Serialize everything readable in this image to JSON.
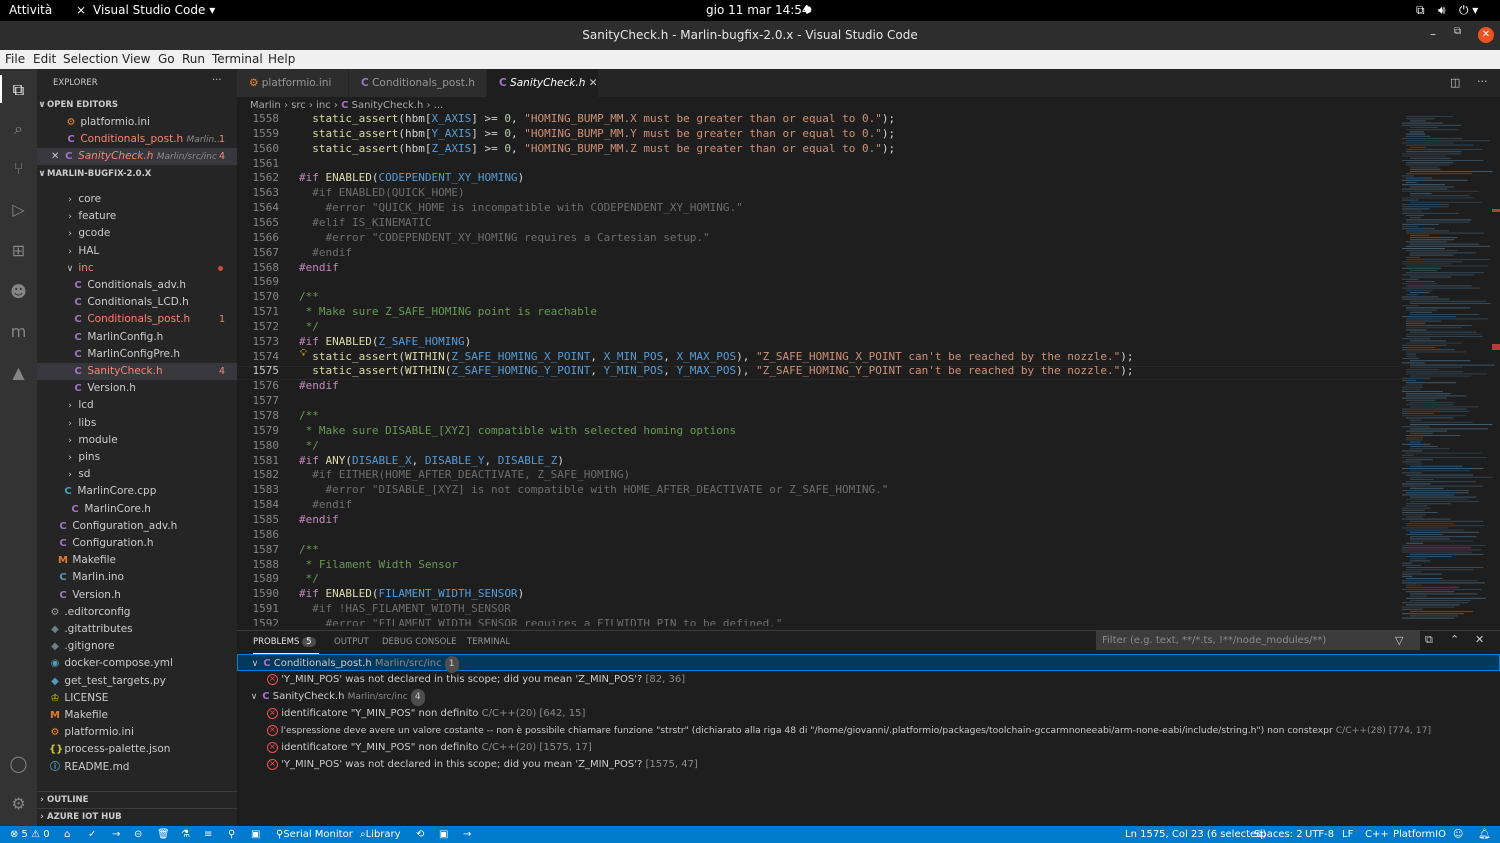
{
  "os_bar": {
    "activities": "Attività",
    "app_name": "Visual Studio Code",
    "clock": "gio 11 mar  14:54"
  },
  "window": {
    "title": "SanityCheck.h - Marlin-bugfix-2.0.x - Visual Studio Code"
  },
  "menu": [
    "File",
    "Edit",
    "Selection",
    "View",
    "Go",
    "Run",
    "Terminal",
    "Help"
  ],
  "sidebar": {
    "title": "EXPLORER",
    "open_editors_header": "OPEN EDITORS",
    "open_editors": [
      {
        "name": "platformio.ini",
        "path": "",
        "badge": ""
      },
      {
        "name": "Conditionals_post.h",
        "path": "Marlin...",
        "badge": "1"
      },
      {
        "name": "SanityCheck.h",
        "path": "Marlin/src/inc",
        "badge": "4"
      }
    ],
    "project_header": "MARLIN-BUGFIX-2.0.X",
    "tree": [
      {
        "name": "core",
        "type": "folder"
      },
      {
        "name": "feature",
        "type": "folder"
      },
      {
        "name": "gcode",
        "type": "folder"
      },
      {
        "name": "HAL",
        "type": "folder"
      },
      {
        "name": "inc",
        "type": "folder-open"
      },
      {
        "name": "Conditionals_adv.h",
        "type": "c"
      },
      {
        "name": "Conditionals_LCD.h",
        "type": "c"
      },
      {
        "name": "Conditionals_post.h",
        "type": "c",
        "badge": "1"
      },
      {
        "name": "MarlinConfig.h",
        "type": "c"
      },
      {
        "name": "MarlinConfigPre.h",
        "type": "c"
      },
      {
        "name": "SanityCheck.h",
        "type": "c",
        "badge": "4"
      },
      {
        "name": "Version.h",
        "type": "c"
      },
      {
        "name": "lcd",
        "type": "folder"
      },
      {
        "name": "libs",
        "type": "folder"
      },
      {
        "name": "module",
        "type": "folder"
      },
      {
        "name": "pins",
        "type": "folder"
      },
      {
        "name": "sd",
        "type": "folder"
      },
      {
        "name": "MarlinCore.cpp",
        "type": "cpp"
      },
      {
        "name": "MarlinCore.h",
        "type": "c"
      },
      {
        "name": "Configuration_adv.h",
        "type": "c"
      },
      {
        "name": "Configuration.h",
        "type": "c"
      },
      {
        "name": "Makefile",
        "type": "make"
      },
      {
        "name": "Marlin.ino",
        "type": "ino"
      },
      {
        "name": "Version.h",
        "type": "c"
      },
      {
        "name": ".editorconfig",
        "type": "gear"
      },
      {
        "name": ".gitattributes",
        "type": "git"
      },
      {
        "name": ".gitignore",
        "type": "git"
      },
      {
        "name": "docker-compose.yml",
        "type": "docker"
      },
      {
        "name": "get_test_targets.py",
        "type": "py"
      },
      {
        "name": "LICENSE",
        "type": "license"
      },
      {
        "name": "Makefile",
        "type": "make"
      },
      {
        "name": "platformio.ini",
        "type": "pio"
      },
      {
        "name": "process-palette.json",
        "type": "json"
      },
      {
        "name": "README.md",
        "type": "md"
      }
    ],
    "outline": "OUTLINE",
    "azure": "AZURE IOT HUB"
  },
  "tabs": [
    {
      "label": "platformio.ini",
      "active": false
    },
    {
      "label": "Conditionals_post.h",
      "active": false
    },
    {
      "label": "SanityCheck.h",
      "active": true
    }
  ],
  "breadcrumb": [
    "Marlin",
    "src",
    "inc",
    "SanityCheck.h",
    "..."
  ],
  "code_lines": [
    {
      "n": "1558",
      "t": "  static_assert(hbm[X_AXIS] >= 0, \"HOMING_BUMP_MM.X must be greater than or equal to 0.\");"
    },
    {
      "n": "1559",
      "t": "  static_assert(hbm[Y_AXIS] >= 0, \"HOMING_BUMP_MM.Y must be greater than or equal to 0.\");"
    },
    {
      "n": "1560",
      "t": "  static_assert(hbm[Z_AXIS] >= 0, \"HOMING_BUMP_MM.Z must be greater than or equal to 0.\");"
    },
    {
      "n": "1561",
      "t": ""
    },
    {
      "n": "1562",
      "t": "#if ENABLED(CODEPENDENT_XY_HOMING)"
    },
    {
      "n": "1563",
      "t": "  #if ENABLED(QUICK_HOME)"
    },
    {
      "n": "1564",
      "t": "    #error \"QUICK_HOME is incompatible with CODEPENDENT_XY_HOMING.\""
    },
    {
      "n": "1565",
      "t": "  #elif IS_KINEMATIC"
    },
    {
      "n": "1566",
      "t": "    #error \"CODEPENDENT_XY_HOMING requires a Cartesian setup.\""
    },
    {
      "n": "1567",
      "t": "  #endif"
    },
    {
      "n": "1568",
      "t": "#endif"
    },
    {
      "n": "1569",
      "t": ""
    },
    {
      "n": "1570",
      "t": "/**"
    },
    {
      "n": "1571",
      "t": " * Make sure Z_SAFE_HOMING point is reachable"
    },
    {
      "n": "1572",
      "t": " */"
    },
    {
      "n": "1573",
      "t": "#if ENABLED(Z_SAFE_HOMING)"
    },
    {
      "n": "1574",
      "t": "  static_assert(WITHIN(Z_SAFE_HOMING_X_POINT, X_MIN_POS, X_MAX_POS), \"Z_SAFE_HOMING_X_POINT can't be reached by the nozzle.\");"
    },
    {
      "n": "1575",
      "t": "  static_assert(WITHIN(Z_SAFE_HOMING_Y_POINT, Y_MIN_POS, Y_MAX_POS), \"Z_SAFE_HOMING_Y_POINT can't be reached by the nozzle.\");"
    },
    {
      "n": "1576",
      "t": "#endif"
    },
    {
      "n": "1577",
      "t": ""
    },
    {
      "n": "1578",
      "t": "/**"
    },
    {
      "n": "1579",
      "t": " * Make sure DISABLE_[XYZ] compatible with selected homing options"
    },
    {
      "n": "1580",
      "t": " */"
    },
    {
      "n": "1581",
      "t": "#if ANY(DISABLE_X, DISABLE_Y, DISABLE_Z)"
    },
    {
      "n": "1582",
      "t": "  #if EITHER(HOME_AFTER_DEACTIVATE, Z_SAFE_HOMING)"
    },
    {
      "n": "1583",
      "t": "    #error \"DISABLE_[XYZ] is not compatible with HOME_AFTER_DEACTIVATE or Z_SAFE_HOMING.\""
    },
    {
      "n": "1584",
      "t": "  #endif"
    },
    {
      "n": "1585",
      "t": "#endif"
    },
    {
      "n": "1586",
      "t": ""
    },
    {
      "n": "1587",
      "t": "/**"
    },
    {
      "n": "1588",
      "t": " * Filament Width Sensor"
    },
    {
      "n": "1589",
      "t": " */"
    },
    {
      "n": "1590",
      "t": "#if ENABLED(FILAMENT_WIDTH_SENSOR)"
    },
    {
      "n": "1591",
      "t": "  #if !HAS_FILAMENT_WIDTH_SENSOR"
    },
    {
      "n": "1592",
      "t": "    #error \"FILAMENT_WIDTH_SENSOR requires a FILWIDTH_PIN to be defined.\""
    }
  ],
  "panel": {
    "tabs": [
      "PROBLEMS",
      "OUTPUT",
      "DEBUG CONSOLE",
      "TERMINAL"
    ],
    "problems_count": "5",
    "filter_placeholder": "Filter (e.g. text, **/*.ts, !**/node_modules/**)",
    "groups": [
      {
        "file": "Conditionals_post.h",
        "path": "Marlin/src/inc",
        "count": "1",
        "items": [
          {
            "msg": "'Y_MIN_POS' was not declared in this scope; did you mean 'Z_MIN_POS'?",
            "src": "",
            "loc": "[82, 36]"
          }
        ]
      },
      {
        "file": "SanityCheck.h",
        "path": "Marlin/src/inc",
        "count": "4",
        "items": [
          {
            "msg": "identificatore \"Y_MIN_POS\" non definito",
            "src": "C/C++(20)",
            "loc": "[642, 15]"
          },
          {
            "msg": "l'espressione deve avere un valore costante -- non è possibile chiamare funzione \"strstr\" (dichiarato alla riga 48 di \"/home/giovanni/.platformio/packages/toolchain-gccarmnoneeabi/arm-none-eabi/include/string.h\") non constexpr",
            "src": "C/C++(28)",
            "loc": "[774, 17]"
          },
          {
            "msg": "identificatore \"Y_MIN_POS\" non definito",
            "src": "C/C++(20)",
            "loc": "[1575, 17]"
          },
          {
            "msg": "'Y_MIN_POS' was not declared in this scope; did you mean 'Z_MIN_POS'?",
            "src": "",
            "loc": "[1575, 47]"
          }
        ]
      }
    ]
  },
  "status": {
    "problems": "⊗ 5 ⚠ 0",
    "serial_monitor": "Serial Monitor",
    "library": "Library",
    "cursor": "Ln 1575, Col 23 (6 selected)",
    "spaces": "Spaces: 2",
    "encoding": "UTF-8",
    "eol": "LF",
    "language": "C++",
    "platform": "PlatformIO"
  },
  "colors": {
    "accent": "#007acc",
    "error": "#f14c4c",
    "modified_file": "#f48771"
  }
}
